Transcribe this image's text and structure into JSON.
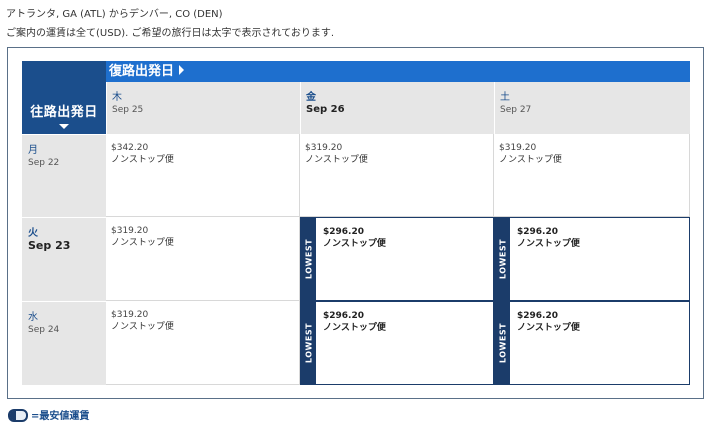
{
  "header": {
    "route": "アトランタ, GA (ATL) からデンバー, CO (DEN)",
    "note": "ご案内の運賃は全て(USD). ご希望の旅行日は太字で表示されております."
  },
  "grid": {
    "outbound_label": "往路出発日",
    "return_label": "復路出発日",
    "lowest_tag": "LOWEST",
    "columns": [
      {
        "dow": "木",
        "date": "Sep 25"
      },
      {
        "dow": "金",
        "date": "Sep 26"
      },
      {
        "dow": "土",
        "date": "Sep 27"
      }
    ],
    "rows": [
      {
        "dow": "月",
        "date": "Sep 22",
        "cells": [
          {
            "price": "$342.20",
            "stops": "ノンストップ便",
            "lowest": false
          },
          {
            "price": "$319.20",
            "stops": "ノンストップ便",
            "lowest": false
          },
          {
            "price": "$319.20",
            "stops": "ノンストップ便",
            "lowest": false
          }
        ]
      },
      {
        "dow": "火",
        "date": "Sep 23",
        "cells": [
          {
            "price": "$319.20",
            "stops": "ノンストップ便",
            "lowest": false
          },
          {
            "price": "$296.20",
            "stops": "ノンストップ便",
            "lowest": true
          },
          {
            "price": "$296.20",
            "stops": "ノンストップ便",
            "lowest": true
          }
        ]
      },
      {
        "dow": "水",
        "date": "Sep 24",
        "cells": [
          {
            "price": "$319.20",
            "stops": "ノンストップ便",
            "lowest": false
          },
          {
            "price": "$296.20",
            "stops": "ノンストップ便",
            "lowest": true
          },
          {
            "price": "$296.20",
            "stops": "ノンストップ便",
            "lowest": true
          }
        ]
      }
    ]
  },
  "legend": {
    "label": "=最安値運賃"
  },
  "colors": {
    "header_blue": "#1b4e8c",
    "return_bar": "#1e6fce",
    "lowest_tag": "#1b3c6a"
  }
}
